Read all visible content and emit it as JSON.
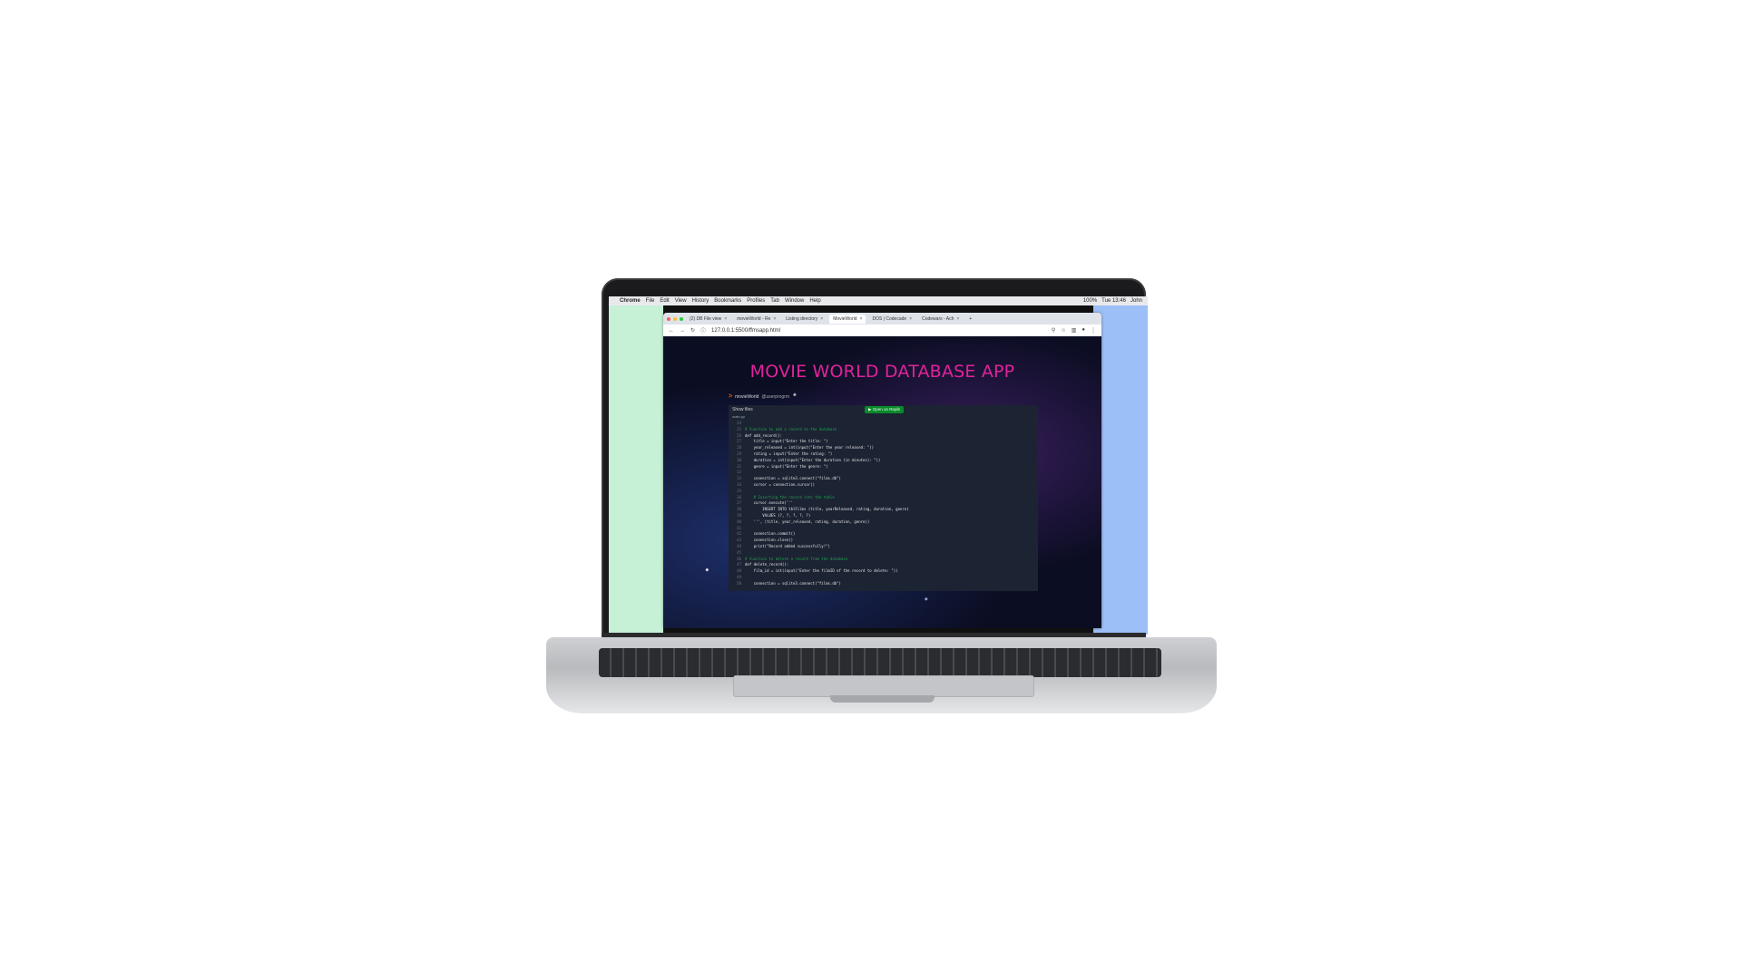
{
  "menubar": {
    "apple": "",
    "items": [
      "Chrome",
      "File",
      "Edit",
      "View",
      "History",
      "Bookmarks",
      "Profiles",
      "Tab",
      "Window",
      "Help"
    ],
    "status": [
      "100%",
      "Tue 13:46",
      "John"
    ]
  },
  "browser": {
    "tabs": [
      {
        "label": "(2) DB File view",
        "active": false
      },
      {
        "label": "movieWorld - Re",
        "active": false
      },
      {
        "label": "Listing directory",
        "active": false
      },
      {
        "label": "MovieWorld",
        "active": true
      },
      {
        "label": "DOS | Codecade",
        "active": false
      },
      {
        "label": "Codewars - Ach",
        "active": false
      }
    ],
    "url": "127.0.0.1:5500/ffmsapp.html"
  },
  "page": {
    "title": "MOVIE WORLD DATABASE APP",
    "repl": {
      "name": "movieWorld",
      "user": "@userprogrm",
      "show_files": "Show files",
      "open_button": "▶ Open on Replit",
      "file_name": "main.py"
    },
    "code_lines": [
      {
        "n": "24",
        "text": "",
        "type": "default"
      },
      {
        "n": "25",
        "text": "# Function to add a record to the database",
        "type": "comment"
      },
      {
        "n": "26",
        "text": "def add_record():",
        "type": "default"
      },
      {
        "n": "27",
        "text": "    title = input(\"Enter the title: \")",
        "type": "default"
      },
      {
        "n": "28",
        "text": "    year_released = int(input(\"Enter the year released: \"))",
        "type": "default"
      },
      {
        "n": "29",
        "text": "    rating = input(\"Enter the rating: \")",
        "type": "default"
      },
      {
        "n": "30",
        "text": "    duration = int(input(\"Enter the duration (in minutes): \"))",
        "type": "default"
      },
      {
        "n": "31",
        "text": "    genre = input(\"Enter the genre: \")",
        "type": "default"
      },
      {
        "n": "32",
        "text": "",
        "type": "default"
      },
      {
        "n": "33",
        "text": "    connection = sqlite3.connect(\"films.db\")",
        "type": "default"
      },
      {
        "n": "34",
        "text": "    cursor = connection.cursor()",
        "type": "default"
      },
      {
        "n": "35",
        "text": "",
        "type": "default"
      },
      {
        "n": "36",
        "text": "    # Inserting the record into the table",
        "type": "comment"
      },
      {
        "n": "37",
        "text": "    cursor.execute('''",
        "type": "default"
      },
      {
        "n": "38",
        "text": "        INSERT INTO tblFilms (title, yearReleased, rating, duration, genre)",
        "type": "default"
      },
      {
        "n": "39",
        "text": "        VALUES (?, ?, ?, ?, ?)",
        "type": "default"
      },
      {
        "n": "40",
        "text": "    ''', (title, year_released, rating, duration, genre))",
        "type": "default"
      },
      {
        "n": "41",
        "text": "",
        "type": "default"
      },
      {
        "n": "42",
        "text": "    connection.commit()",
        "type": "default"
      },
      {
        "n": "43",
        "text": "    connection.close()",
        "type": "default"
      },
      {
        "n": "44",
        "text": "    print(\"Record added successfully!\")",
        "type": "default"
      },
      {
        "n": "45",
        "text": "",
        "type": "default"
      },
      {
        "n": "46",
        "text": "# Function to delete a record from the database",
        "type": "comment"
      },
      {
        "n": "47",
        "text": "def delete_record():",
        "type": "default"
      },
      {
        "n": "48",
        "text": "    film_id = int(input(\"Enter the filmID of the record to delete: \"))",
        "type": "default"
      },
      {
        "n": "49",
        "text": "",
        "type": "default"
      },
      {
        "n": "50",
        "text": "    connection = sqlite3.connect(\"films.db\")",
        "type": "default"
      }
    ]
  },
  "colors": {
    "title": "#e0239a",
    "code_comment": "#22a44f",
    "open_button": "#0a8a2b",
    "panel": "#1c2333",
    "wall_left": "#c6f1d6",
    "wall_right": "#9dbff7"
  }
}
